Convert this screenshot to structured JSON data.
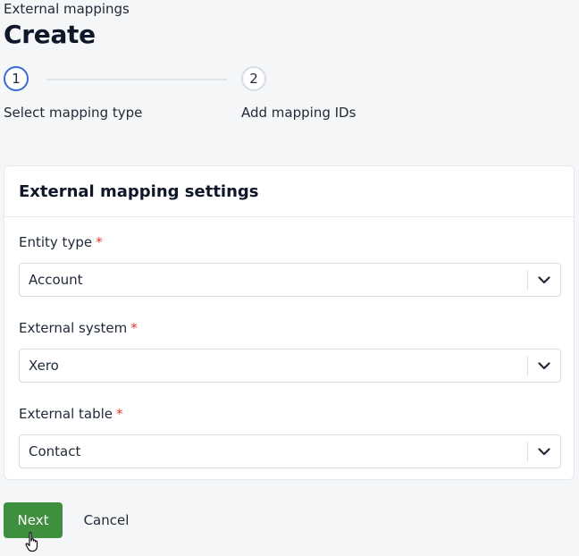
{
  "header": {
    "breadcrumb": "External mappings",
    "title": "Create"
  },
  "stepper": {
    "steps": [
      {
        "number": "1",
        "label": "Select mapping type",
        "state": "active"
      },
      {
        "number": "2",
        "label": "Add mapping IDs",
        "state": "inactive"
      }
    ]
  },
  "card": {
    "title": "External mapping settings",
    "fields": [
      {
        "label": "Entity type",
        "required_mark": "*",
        "value": "Account"
      },
      {
        "label": "External system",
        "required_mark": "*",
        "value": "Xero"
      },
      {
        "label": "External table",
        "required_mark": "*",
        "value": "Contact"
      }
    ]
  },
  "actions": {
    "next_label": "Next",
    "cancel_label": "Cancel"
  },
  "colors": {
    "accent": "#3b6bd6",
    "primary_button": "#3f8f3f",
    "required": "#e53935"
  },
  "icons": {
    "select_chevron": "chevron-down-icon",
    "cursor": "hand-pointer-icon"
  }
}
